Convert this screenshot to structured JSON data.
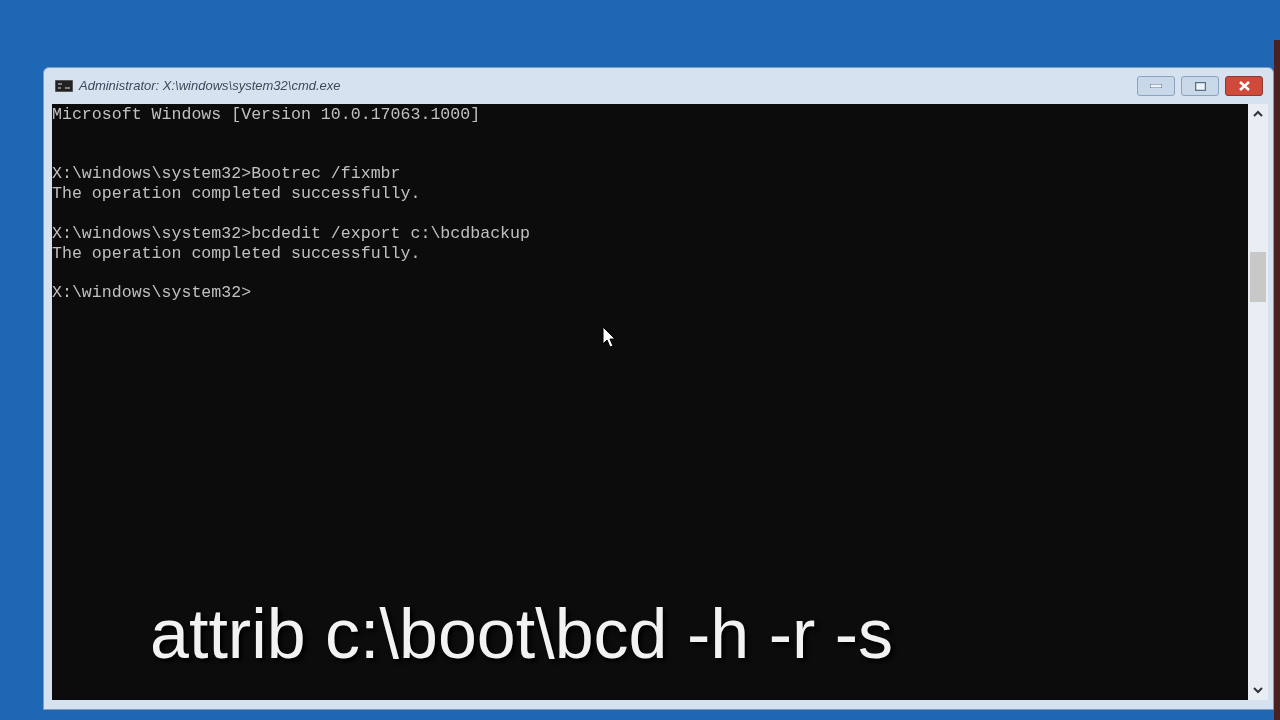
{
  "window": {
    "title": "Administrator: X:\\windows\\system32\\cmd.exe"
  },
  "console_lines": [
    {
      "kind": "text",
      "text": "Microsoft Windows [Version 10.0.17063.1000]"
    },
    {
      "kind": "blank"
    },
    {
      "kind": "blank"
    },
    {
      "kind": "text",
      "text": "X:\\windows\\system32>Bootrec /fixmbr"
    },
    {
      "kind": "text",
      "text": "The operation completed successfully."
    },
    {
      "kind": "blank"
    },
    {
      "kind": "text",
      "text": "X:\\windows\\system32>bcdedit /export c:\\bcdbackup"
    },
    {
      "kind": "text",
      "text": "The operation completed successfully."
    },
    {
      "kind": "blank"
    },
    {
      "kind": "text",
      "text": "X:\\windows\\system32>"
    }
  ],
  "caption": "attrib c:\\boot\\bcd -h -r -s"
}
